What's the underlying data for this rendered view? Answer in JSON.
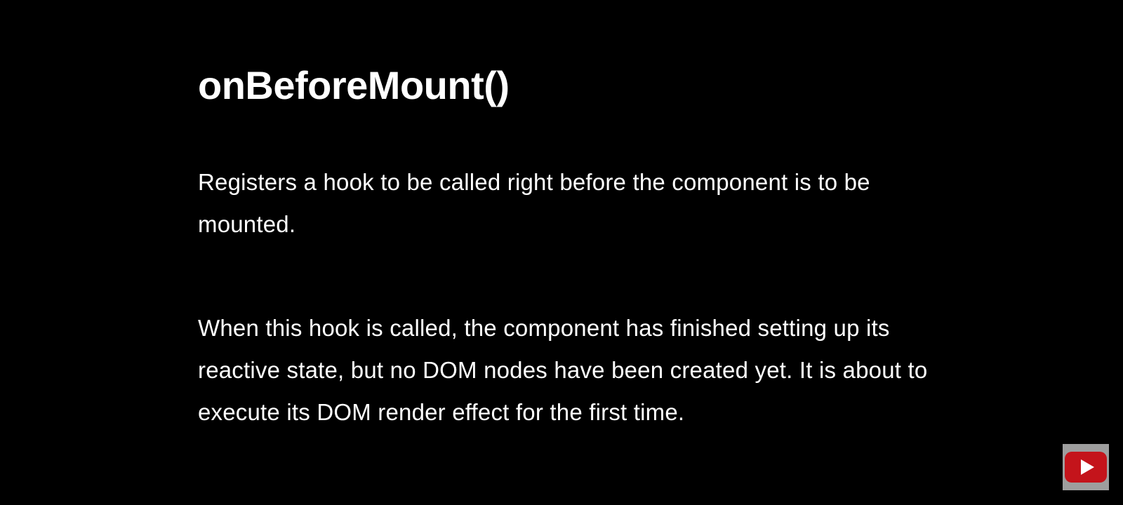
{
  "slide": {
    "title": "onBeforeMount()",
    "paragraphs": [
      "Registers a hook to be called right before the component is to be mounted.",
      "When this hook is called, the component has finished setting up its reactive state, but no DOM nodes have been created yet. It is about to execute its DOM render effect for the first time."
    ]
  },
  "overlay": {
    "icon": "youtube-icon",
    "colors": {
      "button_background": "#9e9e9e",
      "logo_red": "#c4141b",
      "play_triangle": "#ffffff"
    }
  },
  "colors": {
    "background": "#000000",
    "text": "#ffffff"
  }
}
